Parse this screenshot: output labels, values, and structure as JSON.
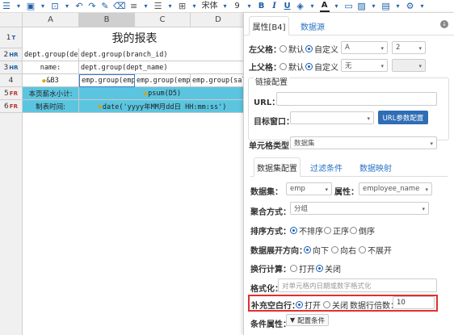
{
  "toolbar": {
    "font_name": "宋体",
    "font_size": "9",
    "bold": "B",
    "italic": "I",
    "underline": "U",
    "font_color": "A"
  },
  "sheet": {
    "columns": [
      "A",
      "B",
      "C",
      "D"
    ],
    "title": "我的报表",
    "rows": [
      {
        "num": "1",
        "suffix": "T"
      },
      {
        "num": "2",
        "suffix": "HR"
      },
      {
        "num": "3",
        "suffix": "HR"
      },
      {
        "num": "4",
        "suffix": ""
      },
      {
        "num": "5",
        "suffix": "FR"
      },
      {
        "num": "6",
        "suffix": "FR"
      }
    ],
    "r2": {
      "a": "dept.group(dept",
      "b": "dept.group(branch_id)"
    },
    "r3": {
      "a": "name:",
      "b": "dept.group(dept_name)"
    },
    "r4": {
      "a": "&B3",
      "b": "emp.group(employ",
      "c": "emp.group(employe",
      "d": "emp.group(salary"
    },
    "r5": {
      "a": "本页薪水小计:",
      "b": "psum(D5)"
    },
    "r6": {
      "a": "制表时间:",
      "b": "date('yyyy年MM月dd日 HH:mm:ss')"
    }
  },
  "panel": {
    "tabs": [
      "属性[B4]",
      "数据源"
    ],
    "left_parent": {
      "label": "左父格：",
      "opt_default": "默认",
      "opt_custom": "自定义",
      "select1": "A",
      "select2": "2"
    },
    "top_parent": {
      "label": "上父格：",
      "opt_default": "默认",
      "opt_custom": "自定义",
      "select1": "无",
      "select2": ""
    },
    "link": {
      "title": "链接配置",
      "url_label": "URL：",
      "url_value": "",
      "target_label": "目标窗口：",
      "target_value": "",
      "url_param_button": "URL参数配置"
    },
    "cell_type": {
      "label": "单元格类型：",
      "value": "数据集"
    },
    "sub_tabs": [
      "数据集配置",
      "过滤条件",
      "数据映射"
    ],
    "dataset": {
      "label": "数据集：",
      "value": "emp",
      "attr_label": "属性：",
      "attr_value": "employee_name"
    },
    "aggregate": {
      "label": "聚合方式：",
      "value": "分组"
    },
    "sort": {
      "label": "排序方式：",
      "options": [
        "不排序",
        "正序",
        "倒序"
      ],
      "selected": 0
    },
    "expand": {
      "label": "数据展开方向：",
      "options": [
        "向下",
        "向右",
        "不展开"
      ],
      "selected": 0
    },
    "wrap": {
      "label": "换行计算：",
      "options": [
        "打开",
        "关闭"
      ],
      "selected": 1
    },
    "format": {
      "label": "格式化：",
      "placeholder": "对单元格内日期或数字格式化"
    },
    "fill_blank": {
      "label": "补充空白行：",
      "options": [
        "打开",
        "关闭"
      ],
      "selected": 0,
      "multiple_label": "数据行倍数：",
      "multiple_value": "10"
    },
    "condition": {
      "label": "条件属性：",
      "button": "配置条件"
    }
  },
  "colors": {
    "accent": "#2f6db5",
    "highlight": "#e03030",
    "sheet_band": "#5bc5e0"
  }
}
